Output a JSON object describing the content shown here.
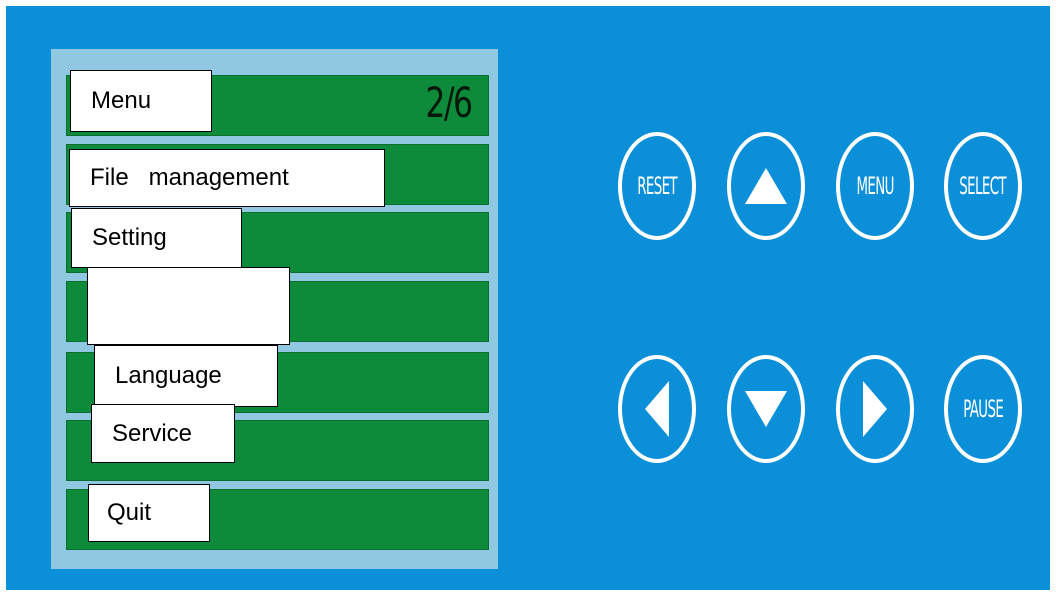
{
  "menu": {
    "page_indicator": "2/6",
    "items": [
      {
        "label": "Menu"
      },
      {
        "label": "File   management"
      },
      {
        "label": "Setting"
      },
      {
        "label": ""
      },
      {
        "label": "Language"
      },
      {
        "label": "Service"
      },
      {
        "label": "Quit"
      }
    ]
  },
  "keypad": {
    "reset_label": "RESET",
    "menu_label": "MENU",
    "select_label": "SELECT",
    "pause_label": "PAUSE",
    "up_icon": "up-arrow-icon",
    "down_icon": "down-arrow-icon",
    "left_icon": "left-arrow-icon",
    "right_icon": "right-arrow-icon"
  },
  "colors": {
    "panel_background": "#0a8fd8",
    "screen_background": "#8fc8e0",
    "row_green": "#0e8b3a",
    "button_outline": "#ffffff"
  }
}
